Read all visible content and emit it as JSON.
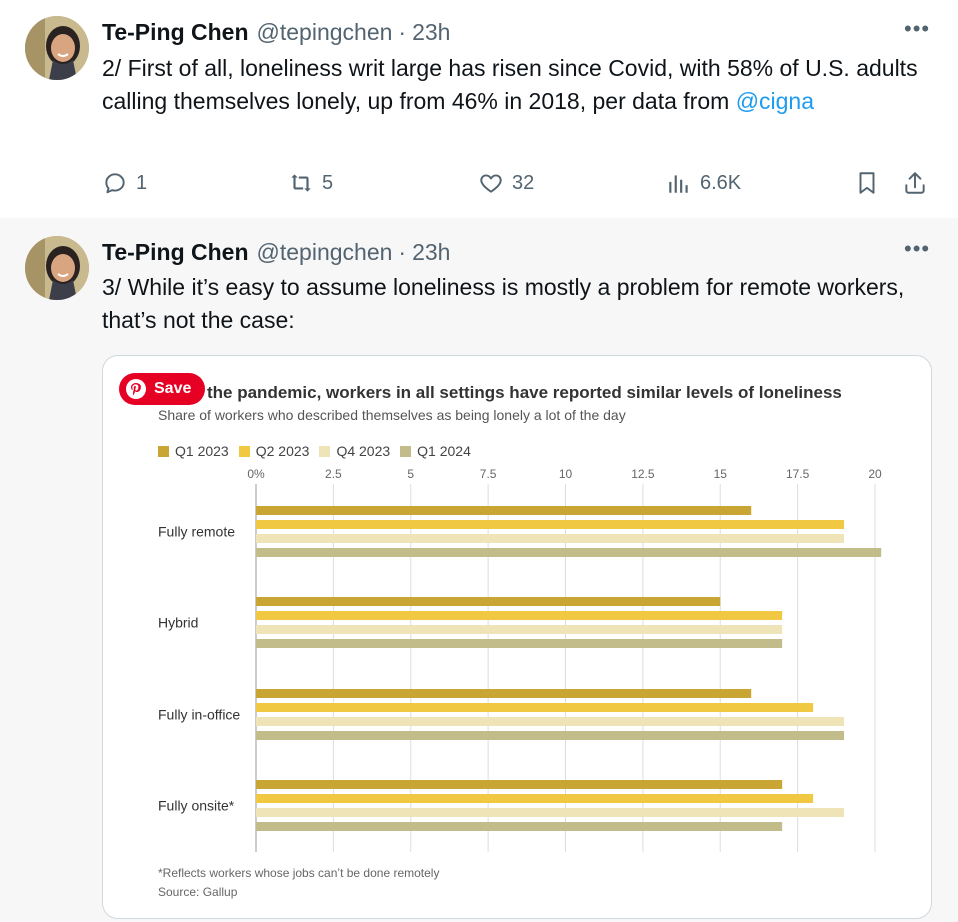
{
  "tweets": [
    {
      "author_name": "Te-Ping Chen",
      "handle": "@tepingchen",
      "separator": "·",
      "time": "23h",
      "more_label": "•••",
      "text": "2/ First of all, loneliness writ large has risen since Covid, with 58% of U.S. adults calling themselves lonely, up from 46% in 2018, per data from ",
      "mention": "@cigna",
      "replies": "1",
      "reposts": "5",
      "likes": "32",
      "views": "6.6K"
    },
    {
      "author_name": "Te-Ping Chen",
      "handle": "@tepingchen",
      "separator": "·",
      "time": "23h",
      "more_label": "•••",
      "text": "3/ While it’s easy to assume loneliness is mostly a problem for remote workers, that’s not the case:"
    }
  ],
  "pinterest": {
    "save_label": "Save"
  },
  "chart_data": {
    "type": "bar",
    "orientation": "horizontal",
    "title": "the pandemic, workers in all settings have reported similar levels of loneliness",
    "subtitle": "Share of workers who described themselves as being lonely a lot of the day",
    "categories": [
      "Fully remote",
      "Hybrid",
      "Fully in-office",
      "Fully onsite*"
    ],
    "series": [
      {
        "name": "Q1 2023",
        "color": "#c9a633",
        "values": [
          16,
          15,
          16,
          17
        ]
      },
      {
        "name": "Q2 2023",
        "color": "#f0c842",
        "values": [
          19,
          17,
          18,
          18
        ]
      },
      {
        "name": "Q4 2023",
        "color": "#efe3b8",
        "values": [
          19,
          17,
          19,
          19
        ]
      },
      {
        "name": "Q1 2024",
        "color": "#c2bb8a",
        "values": [
          20.2,
          17,
          19,
          17
        ]
      }
    ],
    "x_ticks": [
      "0%",
      "2.5",
      "5",
      "7.5",
      "10",
      "12.5",
      "15",
      "17.5",
      "20"
    ],
    "xlim": [
      0,
      20
    ],
    "grid": true,
    "legend_position": "top-left",
    "footnote": "*Reflects workers whose jobs can’t be done remotely",
    "source": "Source: Gallup"
  }
}
